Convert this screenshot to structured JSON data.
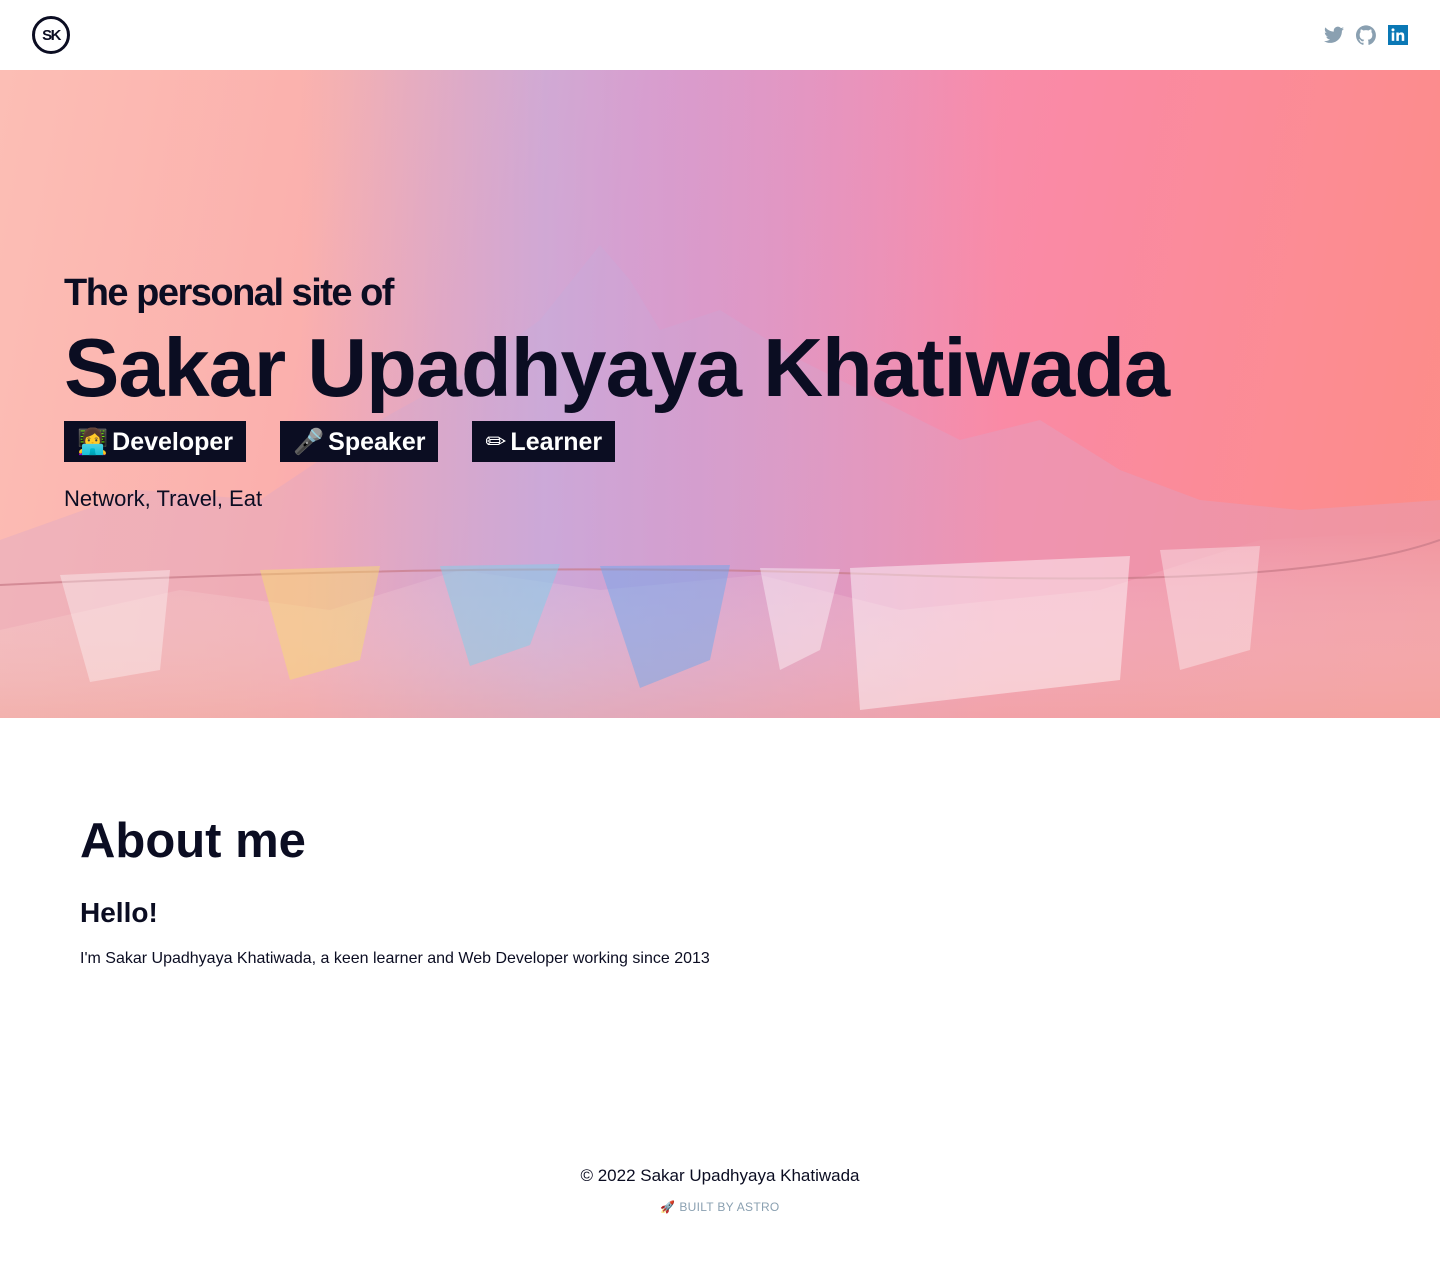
{
  "header": {
    "logo_text": "SK",
    "social": [
      {
        "name": "twitter",
        "icon": "twitter-icon",
        "color": "#8aa0b1"
      },
      {
        "name": "github",
        "icon": "github-icon",
        "color": "#8aa0b1"
      },
      {
        "name": "linkedin",
        "icon": "linkedin-icon",
        "color": "#0a78b5"
      }
    ]
  },
  "hero": {
    "pre_title": "The personal site of",
    "name": "Sakar Upadhyaya Khatiwada",
    "roles": [
      {
        "emoji": "👩‍💻",
        "label": "Developer"
      },
      {
        "emoji": "🎤",
        "label": "Speaker"
      },
      {
        "emoji": "✏",
        "label": "Learner"
      }
    ],
    "tagline": "Network, Travel, Eat"
  },
  "about": {
    "heading": "About me",
    "greeting": "Hello!",
    "text": "I'm Sakar Upadhyaya Khatiwada, a keen learner and Web Developer working since 2013"
  },
  "footer": {
    "copyright": "© 2022 Sakar Upadhyaya Khatiwada",
    "built_emoji": "🚀",
    "built_text": "BUILT BY ASTRO"
  },
  "colors": {
    "text": "#0b0d22",
    "muted": "#8aa0b1",
    "linkedin": "#0a78b5"
  }
}
